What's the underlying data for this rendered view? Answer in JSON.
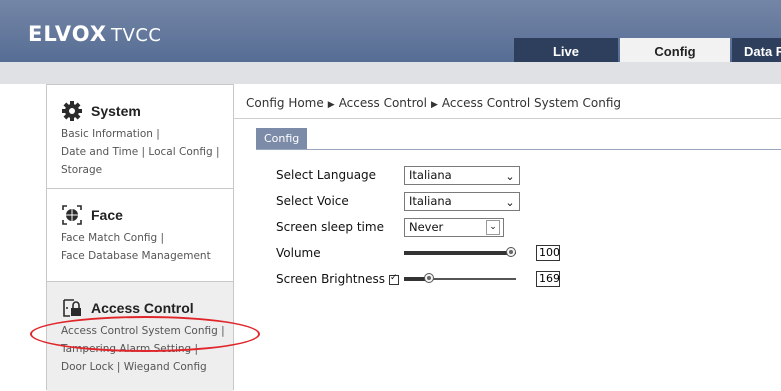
{
  "header": {
    "brand": "ELVOX",
    "sub": "TVCC",
    "tabs": [
      {
        "label": "Live"
      },
      {
        "label": "Config"
      },
      {
        "label": "Data Re"
      }
    ]
  },
  "sidebar": {
    "sections": [
      {
        "title": "System",
        "icon": "gear-icon",
        "links": [
          "Basic Information |",
          "Date and Time | Local Config |",
          "Storage"
        ]
      },
      {
        "title": "Face",
        "icon": "face-icon",
        "links": [
          "Face Match Config |",
          "Face Database Management"
        ]
      },
      {
        "title": "Access Control",
        "icon": "lock-icon",
        "links": [
          "Access Control System Config |",
          "Tampering Alarm Setting |",
          "Door Lock | Wiegand Config"
        ]
      }
    ]
  },
  "breadcrumb": [
    "Config Home",
    "Access Control",
    "Access Control System Config"
  ],
  "subtab": "Config",
  "form": {
    "language_label": "Select Language",
    "language_value": "Italiana",
    "voice_label": "Select Voice",
    "voice_value": "Italiana",
    "sleep_label": "Screen sleep time",
    "sleep_value": "Never",
    "volume_label": "Volume",
    "volume_value": "100",
    "brightness_label": "Screen Brightness",
    "brightness_value": "169",
    "brightness_checked": true
  },
  "levels": {
    "volume_fraction": 1.0,
    "brightness_fraction": 0.2
  },
  "colors": {
    "header": "#566d94",
    "tab_dark": "#2e3f5e",
    "subtab": "#7b8ba8",
    "annotation": "#e0262b"
  }
}
